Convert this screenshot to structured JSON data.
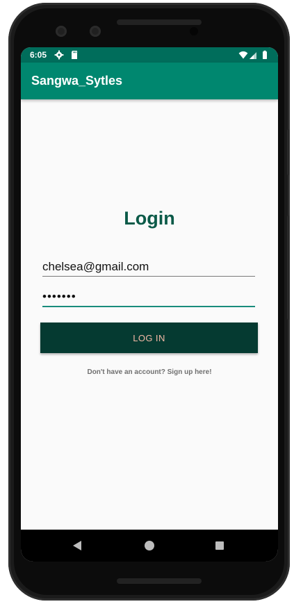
{
  "status_bar": {
    "time": "6:05",
    "left_icons": [
      "gear-icon",
      "sd-card-icon"
    ],
    "right_icons": [
      "wifi-icon",
      "signal-icon",
      "battery-icon"
    ]
  },
  "app_bar": {
    "title": "Sangwa_Sytles"
  },
  "login": {
    "heading": "Login",
    "email_value": "chelsea@gmail.com",
    "password_value": "•••••••",
    "login_button_label": "LOG IN",
    "signup_text": "Don't have an account? Sign up here!"
  },
  "nav_bar": {
    "icons": [
      "back-icon",
      "home-icon",
      "recents-icon"
    ]
  },
  "colors": {
    "primary": "#00876f",
    "primary_dark": "#006d5b",
    "heading": "#0b5a48",
    "button_bg": "#053a31",
    "button_text": "#f4b9a6"
  }
}
